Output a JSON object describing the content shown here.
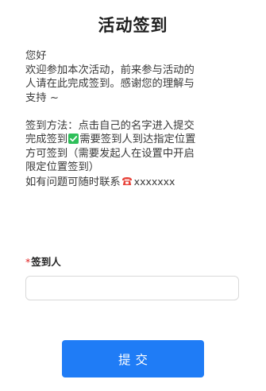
{
  "page": {
    "title": "活动签到"
  },
  "description": {
    "greeting": "您好",
    "intro_lines": [
      "欢迎参加本次活动，前来参与活动的",
      "人请在此完成签到。感谢您的理解与",
      "支持 ~"
    ],
    "method_line_1": "签到方法：点击自己的名字进入提交",
    "method_line_2_before": "完成签到",
    "method_line_2_after": "需要签到人到达指定位置",
    "method_line_3": "方可签到（需要发起人在设置中开启",
    "method_line_4": "限定位置签到）",
    "contact_text": "如有问题可随时联系",
    "contact_number": "xxxxxxx",
    "icons": {
      "check": "check-mark-icon",
      "phone": "telephone-icon"
    }
  },
  "form": {
    "required_mark": "*",
    "name_label": "签到人",
    "name_value": "",
    "name_placeholder": ""
  },
  "actions": {
    "submit_label": "提交"
  },
  "colors": {
    "accent": "#1f7cf6",
    "required": "#e02020",
    "check": "#2fbf5a",
    "phone": "#e8453c"
  }
}
